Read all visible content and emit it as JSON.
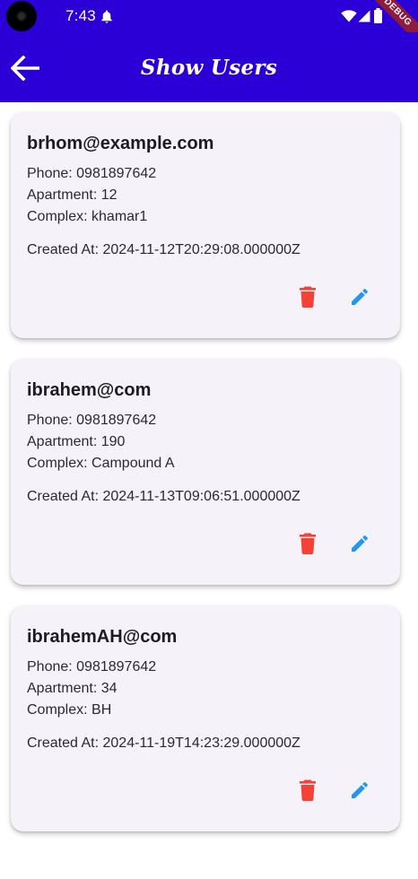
{
  "status_bar": {
    "time": "7:43",
    "icons": [
      "camera-icon",
      "bell-icon",
      "wifi-icon",
      "signal-icon",
      "battery-icon"
    ],
    "debug_label": "DEBUG"
  },
  "app_bar": {
    "title": "Show Users",
    "back_icon": "arrow-back-icon",
    "color": "#2a00d6"
  },
  "users": [
    {
      "email": "brhom@example.com",
      "phone": "Phone: 0981897642",
      "apartment": "Apartment: 12",
      "complex": "Complex: khamar1",
      "created_at": "Created At: 2024-11-12T20:29:08.000000Z"
    },
    {
      "email": "ibrahem@com",
      "phone": "Phone: 0981897642",
      "apartment": "Apartment: 190",
      "complex": "Complex: Campound A",
      "created_at": "Created At: 2024-11-13T09:06:51.000000Z"
    },
    {
      "email": "ibrahemAH@com",
      "phone": "Phone: 0981897642",
      "apartment": "Apartment: 34",
      "complex": "Complex: BH",
      "created_at": "Created At: 2024-11-19T14:23:29.000000Z"
    }
  ],
  "card_actions": {
    "delete_icon": "delete-icon",
    "delete_color": "#f44336",
    "edit_icon": "edit-icon",
    "edit_color": "#2196f3"
  }
}
